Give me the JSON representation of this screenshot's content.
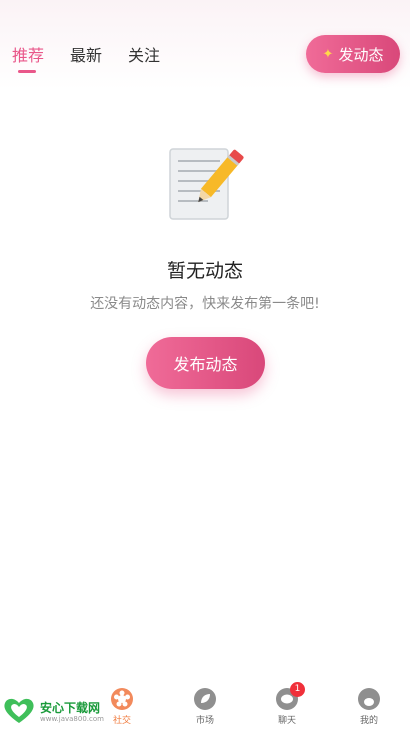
{
  "tabs": [
    {
      "label": "推荐",
      "active": true
    },
    {
      "label": "最新",
      "active": false
    },
    {
      "label": "关注",
      "active": false
    }
  ],
  "header": {
    "post_button_label": "发动态"
  },
  "empty_state": {
    "title": "暂无动态",
    "subtitle": "还没有动态内容，快来发布第一条吧!",
    "button_label": "发布动态"
  },
  "bottom_nav": {
    "items": [
      {
        "label": "社交",
        "active": true
      },
      {
        "label": "市场",
        "active": false
      },
      {
        "label": "聊天",
        "active": false,
        "badge": "1"
      },
      {
        "label": "我的",
        "active": false
      }
    ]
  },
  "watermark": {
    "name": "安心下载网",
    "url": "www.java800.com"
  },
  "colors": {
    "accent": "#e9578a",
    "nav_active": "#f07a3c",
    "badge": "#f0303a"
  }
}
